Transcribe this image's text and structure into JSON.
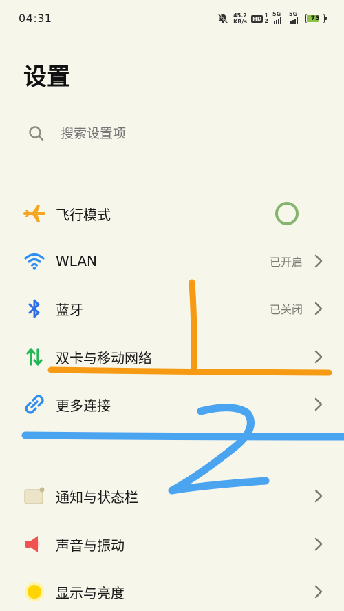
{
  "status_bar": {
    "time": "04:31",
    "net_speed_value": "45.2",
    "net_speed_unit": "KB/s",
    "hd_badge": "HD",
    "sim_index_1": "1",
    "sim_index_2": "2",
    "network_1": "5G",
    "network_2": "5G",
    "battery_level": "75"
  },
  "header": {
    "title": "设置"
  },
  "search": {
    "placeholder": "搜索设置项"
  },
  "settings": {
    "items": [
      {
        "label": "飞行模式",
        "icon": "airplane-icon"
      },
      {
        "label": "WLAN",
        "status": "已开启",
        "icon": "wifi-icon"
      },
      {
        "label": "蓝牙",
        "status": "已关闭",
        "icon": "bluetooth-icon"
      },
      {
        "label": "双卡与移动网络",
        "icon": "mobile-data-icon"
      },
      {
        "label": "更多连接",
        "icon": "link-icon"
      },
      {
        "label": "通知与状态栏",
        "icon": "notification-icon"
      },
      {
        "label": "声音与振动",
        "icon": "speaker-icon"
      },
      {
        "label": "显示与亮度",
        "icon": "brightness-icon"
      }
    ]
  },
  "colors": {
    "background": "#f7f6ea",
    "airplane": "#f5a623",
    "wifi": "#2e8ef0",
    "bluetooth": "#2e6ee6",
    "mobile_data": "#1fb855",
    "link": "#2e8ef0",
    "toggle": "#86b36e",
    "annotation_orange": "#f59a12",
    "annotation_blue": "#4aa4f0"
  },
  "annotations": {
    "label_1": "上",
    "label_2": "2"
  }
}
